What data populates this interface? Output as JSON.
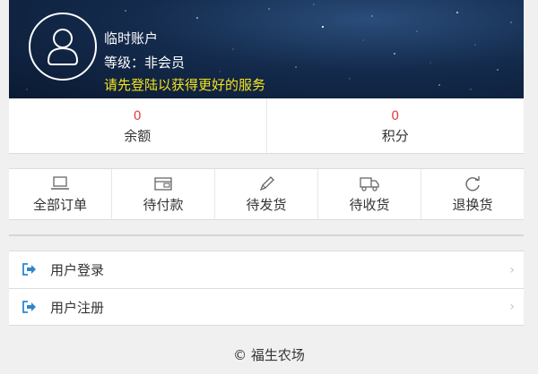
{
  "header": {
    "user_name": "临时账户",
    "user_level": "等级：非会员",
    "login_tip": "请先登陆以获得更好的服务"
  },
  "stats": [
    {
      "value": "0",
      "label": "余额"
    },
    {
      "value": "0",
      "label": "积分"
    }
  ],
  "orders": [
    {
      "icon": "laptop-icon",
      "label": "全部订单"
    },
    {
      "icon": "wallet-icon",
      "label": "待付款"
    },
    {
      "icon": "pencil-icon",
      "label": "待发货"
    },
    {
      "icon": "truck-icon",
      "label": "待收货"
    },
    {
      "icon": "refresh-icon",
      "label": "退换货"
    }
  ],
  "menu": [
    {
      "icon": "sign-in-icon",
      "label": "用户登录"
    },
    {
      "icon": "sign-in-icon",
      "label": "用户注册"
    }
  ],
  "footer": {
    "copyright": "© 福生农场"
  },
  "colors": {
    "tip_yellow": "#f3e21b",
    "stat_red": "#e23b3b",
    "menu_icon_blue": "#2f86c9"
  }
}
